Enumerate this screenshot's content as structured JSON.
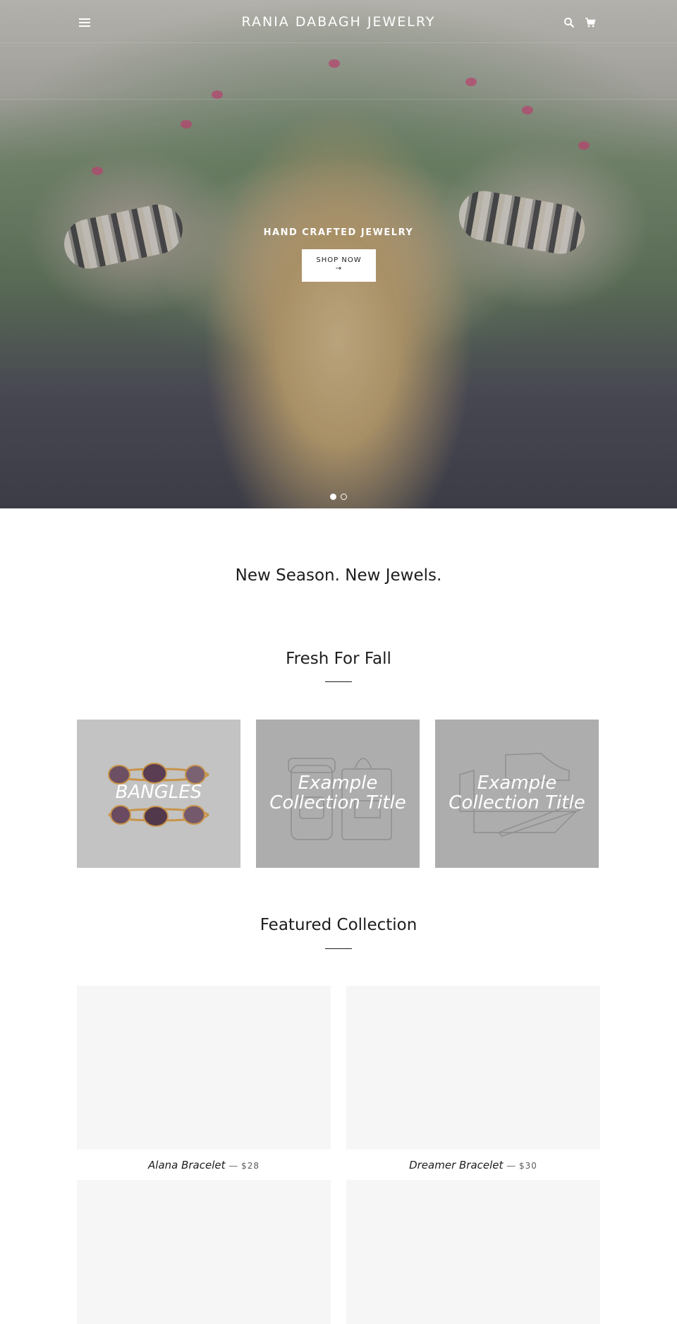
{
  "header": {
    "site_title": "RANIA DABAGH JEWELRY",
    "menu_icon": "hamburger-menu-icon",
    "search_icon": "search-icon",
    "cart_icon": "cart-icon"
  },
  "hero": {
    "caption": "HAND CRAFTED JEWELRY",
    "button_label": "SHOP NOW",
    "button_arrow": "→",
    "slides_count": 2,
    "active_slide": 1
  },
  "tagline": "New Season. New Jewels.",
  "collections_section": {
    "title": "Fresh For Fall",
    "items": [
      {
        "title": "BANGLES"
      },
      {
        "title": "Example Collection Title"
      },
      {
        "title": "Example Collection Title"
      }
    ]
  },
  "featured_section": {
    "title": "Featured Collection",
    "products": [
      {
        "name": "Alana Bracelet",
        "separator": "—",
        "price": "$28"
      },
      {
        "name": "Dreamer Bracelet",
        "separator": "—",
        "price": "$30"
      }
    ]
  },
  "colors": {
    "text": "#1c1d1d",
    "collection_tile_bg": "#adadad",
    "product_placeholder_bg": "#f6f6f6"
  }
}
